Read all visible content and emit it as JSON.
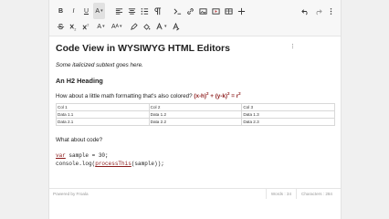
{
  "editor": {
    "title": "Code View in WYSIWYG HTML Editors",
    "subtitle": "Some italicized subtext goes here.",
    "h2": "An H2 Heading",
    "math_question": "How about a little math formatting that's also colored?",
    "math": {
      "t1": "(x-h)",
      "e1": "2",
      "plus": " + ",
      "t2": "(y-k)",
      "e2": "2",
      "eq": " = r",
      "e3": "2"
    },
    "table": {
      "rows": [
        [
          "Col 1",
          "Col 2",
          "Col 3"
        ],
        [
          "Data 1.1",
          "Data 1.2",
          "Data 1.3"
        ],
        [
          "Data 2.1",
          "Data 2.2",
          "Data 2.3"
        ]
      ]
    },
    "code_question": "What about code?",
    "code": {
      "l1_kw": "var",
      "l1_rest": " sample = 30;",
      "l2_pre": "console.log(",
      "l2_fn": "processThis",
      "l2_post": "(sample));"
    }
  },
  "toolbar": {
    "row1_left": [
      "B",
      "I",
      "U",
      "A"
    ],
    "row1_right_icons": [
      "undo-icon",
      "redo-icon",
      "more-vertical-icon"
    ],
    "row2_labels": {
      "font_size": "A",
      "font_size2": "A"
    }
  },
  "statusbar": {
    "powered": "Powered by Froala",
    "words": "Words : 34",
    "characters": "Characters : 284"
  },
  "colors": {
    "accent": "#8b1a1a",
    "toolbar_bg": "#f7f7f7"
  }
}
